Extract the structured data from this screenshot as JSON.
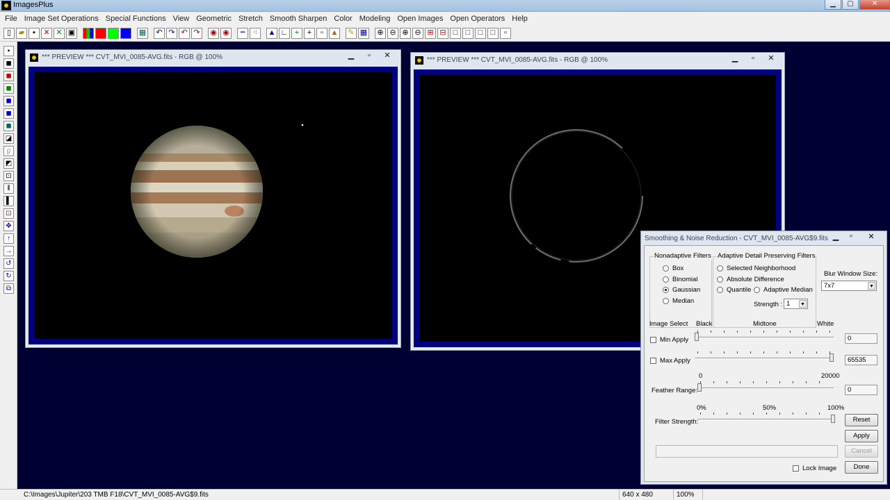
{
  "app": {
    "title": "ImagesPlus"
  },
  "menu": [
    "File",
    "Image Set Operations",
    "Special Functions",
    "View",
    "Geometric",
    "Stretch",
    "Smooth Sharpen",
    "Color",
    "Modeling",
    "Open Images",
    "Open Operators",
    "Help"
  ],
  "preview_left": {
    "title": "*** PREVIEW *** CVT_MVI_0085-AVG.fits - RGB @ 100%"
  },
  "preview_right": {
    "title": "*** PREVIEW *** CVT_MVI_0085-AVG.fits - RGB @ 100%"
  },
  "dialog": {
    "title": "Smoothing & Noise Reduction - CVT_MVI_0085-AVG$9.fits",
    "nonadaptive_label": "Nonadaptive Filters",
    "nonadaptive": [
      {
        "label": "Box",
        "checked": false
      },
      {
        "label": "Binomial",
        "checked": false
      },
      {
        "label": "Gaussian",
        "checked": true
      },
      {
        "label": "Median",
        "checked": false
      }
    ],
    "adaptive_label": "Adaptive Detail Preserving Filters",
    "adaptive": [
      {
        "label": "Selected Neighborhood",
        "checked": false
      },
      {
        "label": "Absolute Difference",
        "checked": false
      },
      {
        "label": "Quantile",
        "checked": false
      },
      {
        "label": "Adaptive Median",
        "checked": false
      }
    ],
    "strength_label": "Strength :",
    "strength_value": "1",
    "blur_label": "Blur Window Size:",
    "blur_value": "7x7",
    "image_select_label": "Image Select",
    "scale_labels": {
      "black": "Black",
      "midtone": "Midtone",
      "white": "White"
    },
    "min_apply_label": "Min Apply",
    "min_apply_value": "0",
    "max_apply_label": "Max Apply",
    "max_apply_value": "65535",
    "feather_min": "0",
    "feather_max": "20000",
    "feather_label": "Feather Range:",
    "feather_value": "0",
    "filter_scale": {
      "p0": "0%",
      "p50": "50%",
      "p100": "100%"
    },
    "filter_strength_label": "Filter Strength:",
    "filter_strength_percent": 100,
    "reset_label": "Reset",
    "apply_label": "Apply",
    "cancel_label": "Cancel",
    "lock_label": "Lock Image",
    "done_label": "Done"
  },
  "status": {
    "path": "C:\\Images\\Jupiter\\203 TMB F18\\CVT_MVI_0085-AVG$9.fits",
    "size": "640 x 480",
    "zoom": "100%"
  }
}
